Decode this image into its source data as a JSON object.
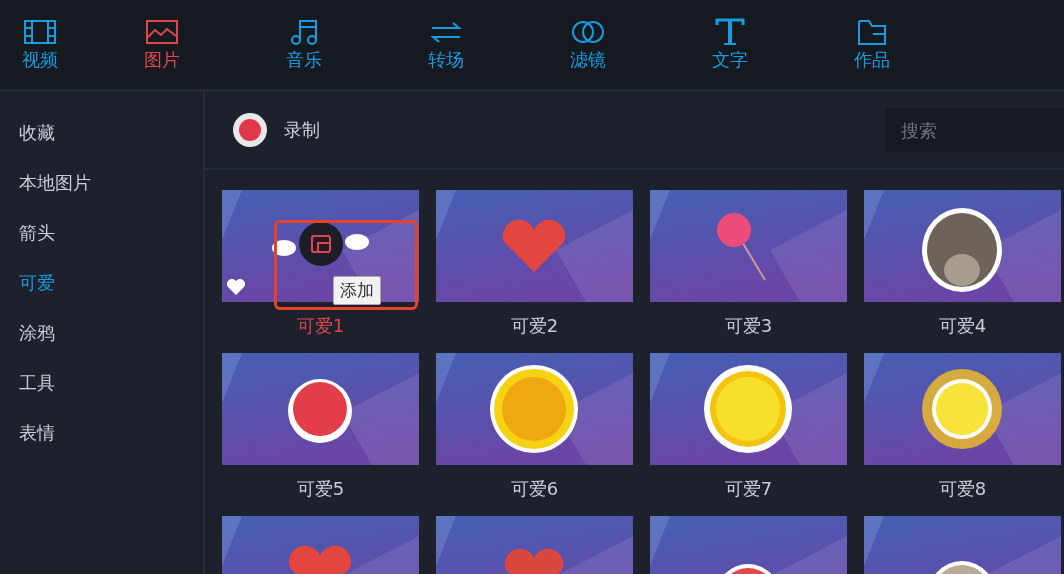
{
  "tabs": [
    {
      "label": "视频",
      "selected": false
    },
    {
      "label": "图片",
      "selected": true
    },
    {
      "label": "音乐",
      "selected": false
    },
    {
      "label": "转场",
      "selected": false
    },
    {
      "label": "滤镜",
      "selected": false
    },
    {
      "label": "文字",
      "selected": false
    },
    {
      "label": "作品",
      "selected": false
    }
  ],
  "sidebar": {
    "items": [
      {
        "label": "收藏",
        "selected": false
      },
      {
        "label": "本地图片",
        "selected": false
      },
      {
        "label": "箭头",
        "selected": false
      },
      {
        "label": "可爱",
        "selected": true
      },
      {
        "label": "涂鸦",
        "selected": false
      },
      {
        "label": "工具",
        "selected": false
      },
      {
        "label": "表情",
        "selected": false
      }
    ]
  },
  "toolbar": {
    "record_label": "录制",
    "search": {
      "placeholder": "搜索"
    }
  },
  "items": [
    {
      "label": "可爱1",
      "selected": true,
      "favorite": true,
      "tooltip": "添加",
      "highlighted": true
    },
    {
      "label": "可爱2",
      "selected": false,
      "favorite": false
    },
    {
      "label": "可爱3",
      "selected": false,
      "favorite": false
    },
    {
      "label": "可爱4",
      "selected": false,
      "favorite": false
    },
    {
      "label": "可爱5",
      "selected": false,
      "favorite": false
    },
    {
      "label": "可爱6",
      "selected": false,
      "favorite": false
    },
    {
      "label": "可爱7",
      "selected": false,
      "favorite": false
    },
    {
      "label": "可爱8",
      "selected": false,
      "favorite": false
    },
    {
      "kind": "picture"
    },
    {
      "kind": "picture"
    },
    {
      "kind": "picture"
    },
    {
      "kind": "picture"
    }
  ]
}
